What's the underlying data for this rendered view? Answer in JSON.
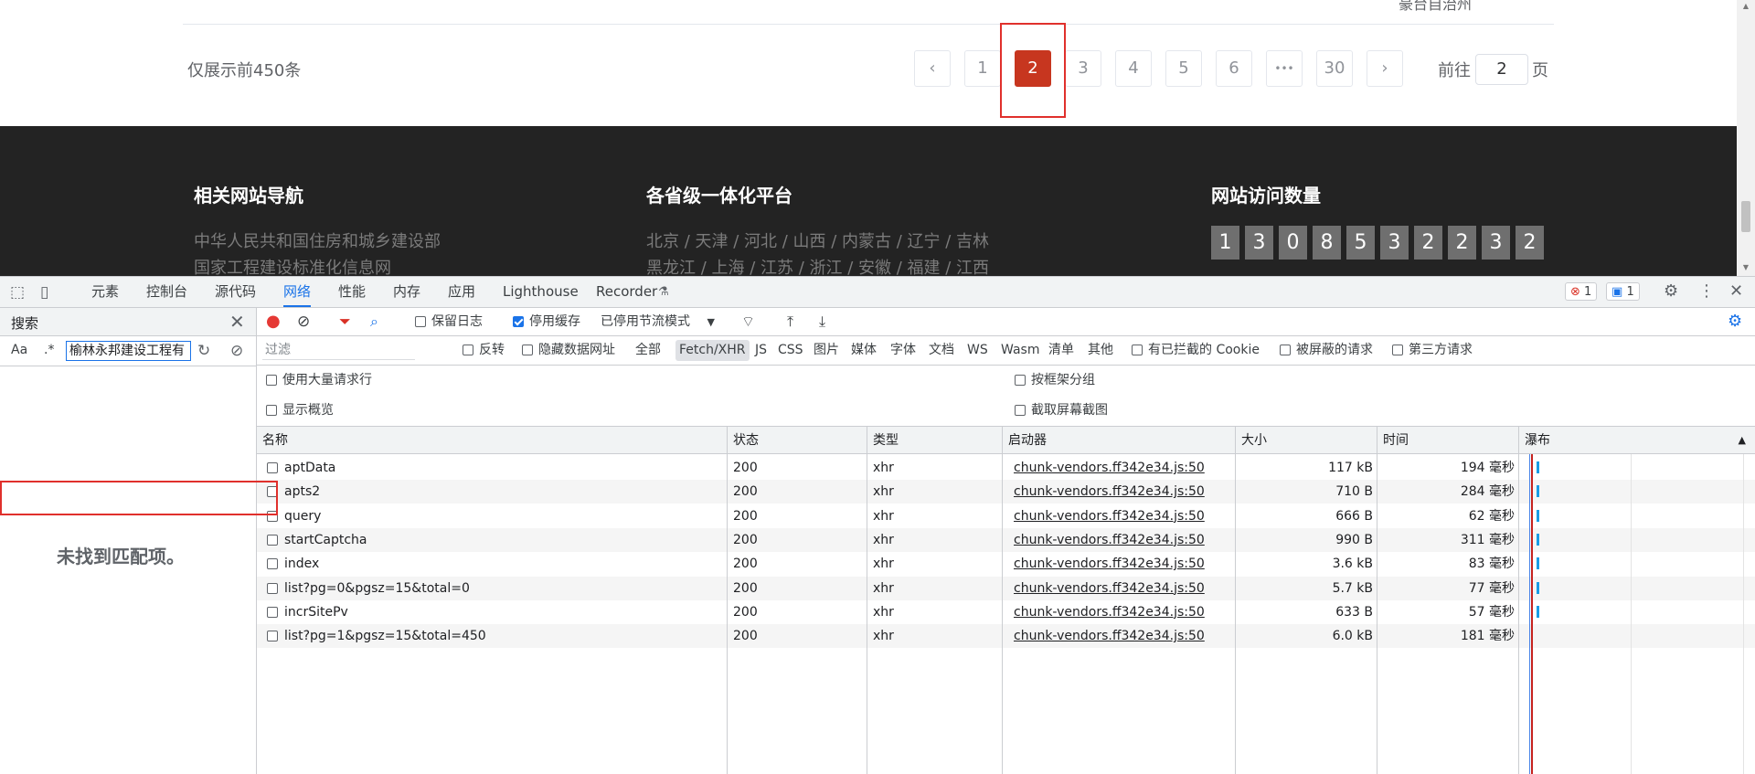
{
  "website": {
    "cutoff_text": "豪台自治州",
    "total_note": "仅展示前450条",
    "pagination": {
      "prev": "‹",
      "next": "›",
      "pages": [
        "1",
        "2",
        "3",
        "4",
        "5",
        "6",
        "•••",
        "30"
      ],
      "current": "2",
      "goto_label": "前往",
      "goto_value": "2",
      "goto_suffix": "页"
    },
    "footer": {
      "nav_title": "相关网站导航",
      "nav_links": [
        "中华人民共和国住房和城乡建设部",
        "国家工程建设标准化信息网"
      ],
      "province_title": "各省级一体化平台",
      "province_rows": [
        "北京 / 天津 / 河北 / 山西 / 内蒙古 / 辽宁 / 吉林",
        "黑龙江 / 上海 / 江苏 / 浙江 / 安徽 / 福建 / 江西"
      ],
      "visits_title": "网站访问数量",
      "visit_digits": [
        "1",
        "3",
        "0",
        "8",
        "5",
        "3",
        "2",
        "2",
        "3",
        "2"
      ]
    }
  },
  "devtools": {
    "tabs": [
      "元素",
      "控制台",
      "源代码",
      "网络",
      "性能",
      "内存",
      "应用",
      "Lighthouse",
      "Recorder"
    ],
    "selected_tab": "网络",
    "error_count": "1",
    "message_count": "1",
    "search": {
      "title": "搜索",
      "case_label": "Aa",
      "regex_label": ".*",
      "query": "榆林永邦建设工程有",
      "empty_message": "未找到匹配项。"
    },
    "network_toolbar": {
      "preserve_log": "保留日志",
      "disable_cache": "停用缓存",
      "throttle": "已停用节流模式"
    },
    "filter": {
      "placeholder": "过滤",
      "invert": "反转",
      "hide_data_urls": "隐藏数据网址",
      "all": "全部",
      "types": [
        "Fetch/XHR",
        "JS",
        "CSS",
        "图片",
        "媒体",
        "字体",
        "文档",
        "WS",
        "Wasm",
        "清单",
        "其他"
      ],
      "selected_type": "Fetch/XHR",
      "blocked_cookies": "有已拦截的 Cookie",
      "blocked_requests": "被屏蔽的请求",
      "third_party": "第三方请求"
    },
    "options": {
      "large_rows": "使用大量请求行",
      "group_by_frame": "按框架分组",
      "show_overview": "显示概览",
      "capture_screenshots": "截取屏幕截图"
    },
    "table": {
      "headers": [
        "名称",
        "状态",
        "类型",
        "启动器",
        "大小",
        "时间",
        "瀑布"
      ],
      "rows": [
        {
          "name": "aptData",
          "status": "200",
          "type": "xhr",
          "initiator": "chunk-vendors.ff342e34.js:50",
          "size": "117 kB",
          "time": "194 毫秒"
        },
        {
          "name": "apts2",
          "status": "200",
          "type": "xhr",
          "initiator": "chunk-vendors.ff342e34.js:50",
          "size": "710 B",
          "time": "284 毫秒"
        },
        {
          "name": "query",
          "status": "200",
          "type": "xhr",
          "initiator": "chunk-vendors.ff342e34.js:50",
          "size": "666 B",
          "time": "62 毫秒"
        },
        {
          "name": "startCaptcha",
          "status": "200",
          "type": "xhr",
          "initiator": "chunk-vendors.ff342e34.js:50",
          "size": "990 B",
          "time": "311 毫秒"
        },
        {
          "name": "index",
          "status": "200",
          "type": "xhr",
          "initiator": "chunk-vendors.ff342e34.js:50",
          "size": "3.6 kB",
          "time": "83 毫秒"
        },
        {
          "name": "list?pg=0&pgsz=15&total=0",
          "status": "200",
          "type": "xhr",
          "initiator": "chunk-vendors.ff342e34.js:50",
          "size": "5.7 kB",
          "time": "77 毫秒"
        },
        {
          "name": "incrSitePv",
          "status": "200",
          "type": "xhr",
          "initiator": "chunk-vendors.ff342e34.js:50",
          "size": "633 B",
          "time": "57 毫秒"
        },
        {
          "name": "list?pg=1&pgsz=15&total=450",
          "status": "200",
          "type": "xhr",
          "initiator": "chunk-vendors.ff342e34.js:50",
          "size": "6.0 kB",
          "time": "181 毫秒"
        }
      ]
    }
  },
  "colors": {
    "page_active": "#c7361f",
    "highlight_box": "#e0302c",
    "devtools_accent": "#1a73e8",
    "record_red": "#e53935"
  }
}
